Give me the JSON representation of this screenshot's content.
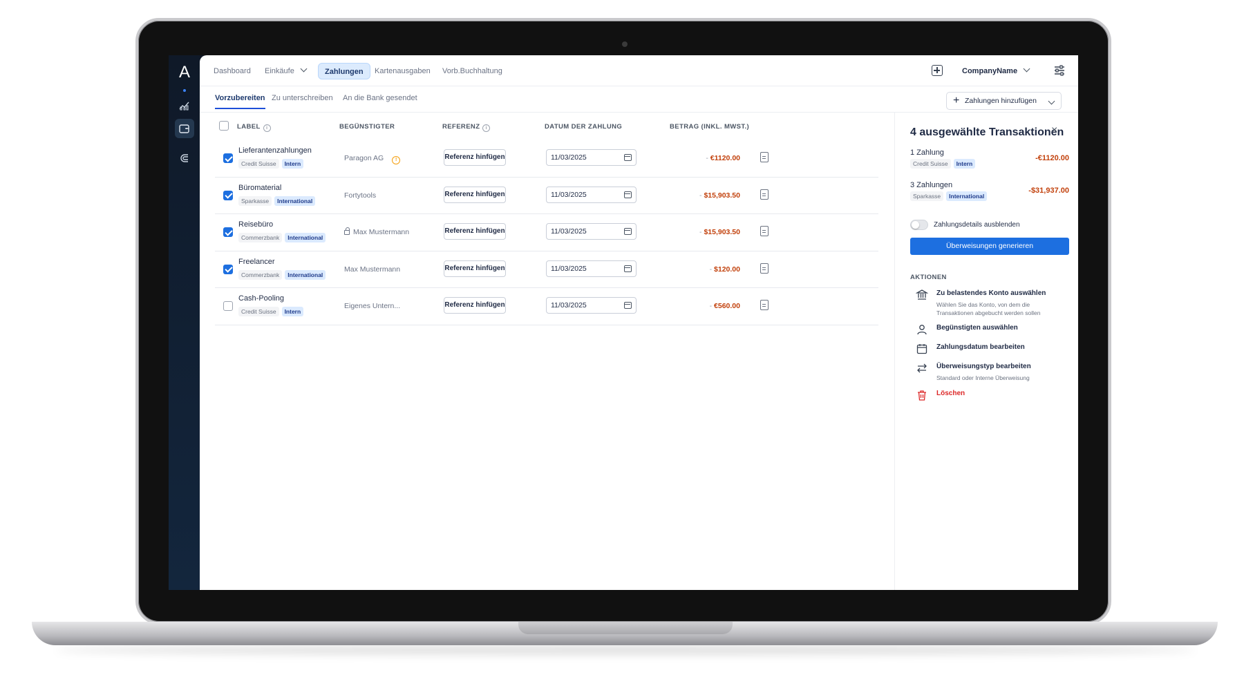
{
  "rail": {
    "logo": "A"
  },
  "nav": {
    "items": [
      {
        "label": "Dashboard"
      },
      {
        "label": "Einkäufe"
      },
      {
        "label": "Zahlungen"
      },
      {
        "label": "Kartenausgaben"
      },
      {
        "label": "Vorb.Buchhaltung"
      }
    ],
    "company": "CompanyName"
  },
  "subtabs": {
    "items": [
      {
        "label": "Vorzubereiten"
      },
      {
        "label": "Zu unterschreiben"
      },
      {
        "label": "An die Bank gesendet"
      }
    ],
    "add_button": "Zahlungen hinzufügen"
  },
  "table": {
    "headers": {
      "label": "LABEL",
      "beneficiary": "BEGÜNSTIGTER",
      "reference": "REFERENZ",
      "date": "DATUM DER ZAHLUNG",
      "amount": "BETRAG (INKL. MWST.)"
    },
    "rows": [
      {
        "label": "Lieferantenzahlungen",
        "bank": "Credit Suisse",
        "kind": "Intern",
        "beneficiary": "Paragon AG",
        "reference": "Referenz hinfügen",
        "date": "11/03/2025",
        "sign": "-",
        "amount": "€1120.00",
        "checked": true
      },
      {
        "label": "Büromaterial",
        "bank": "Sparkasse",
        "kind": "International",
        "beneficiary": "Fortytools",
        "reference": "Referenz hinfügen",
        "date": "11/03/2025",
        "sign": "-",
        "amount": "$15,903.50",
        "checked": true
      },
      {
        "label": "Reisebüro",
        "bank": "Commerzbank",
        "kind": "International",
        "beneficiary": "Max Mustermann",
        "reference": "Referenz hinfügen",
        "date": "11/03/2025",
        "sign": "-",
        "amount": "$15,903.50",
        "checked": true
      },
      {
        "label": "Freelancer",
        "bank": "Commerzbank",
        "kind": "International",
        "beneficiary": "Max Mustermann",
        "reference": "Referenz hinfügen",
        "date": "11/03/2025",
        "sign": "-",
        "amount": "$120.00",
        "checked": true
      },
      {
        "label": "Cash-Pooling",
        "bank": "Credit Suisse",
        "kind": "Intern",
        "beneficiary": "Eigenes Untern...",
        "reference": "Referenz hinfügen",
        "date": "11/03/2025",
        "sign": "-",
        "amount": "€560.00",
        "checked": false
      }
    ]
  },
  "panel": {
    "title": "4 ausgewählte Transaktionen",
    "summaries": [
      {
        "title": "1 Zahlung",
        "bank": "Credit Suisse",
        "kind": "Intern",
        "value": "-€1120.00"
      },
      {
        "title": "3 Zahlungen",
        "bank": "Sparkasse",
        "kind": "International",
        "value": "-$31,937.00"
      }
    ],
    "toggle_label": "Zahlungsdetails ausblenden",
    "generate_button": "Überweisungen generieren",
    "section_title": "AKTIONEN",
    "actions": [
      {
        "title": "Zu belastendes Konto auswählen",
        "desc": "Wählen Sie das Konto, von dem die Transaktionen abgebucht werden sollen"
      },
      {
        "title": "Begünstigten auswählen",
        "desc": ""
      },
      {
        "title": "Zahlungsdatum bearbeiten",
        "desc": ""
      },
      {
        "title": "Überweisungstyp bearbeiten",
        "desc": "Standard oder Interne Überweisung"
      },
      {
        "title": "Löschen",
        "desc": ""
      }
    ]
  },
  "colors": {
    "primary": "#1d6fe0",
    "amount_negative": "#c2410c",
    "danger": "#dc2626"
  }
}
